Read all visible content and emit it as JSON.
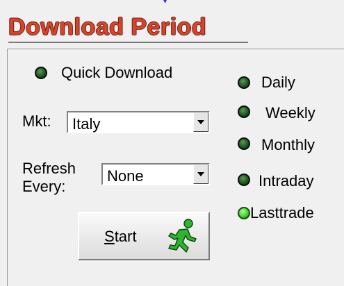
{
  "title": "Download Period",
  "quick_download": {
    "label": "Quick Download"
  },
  "market": {
    "label": "Mkt:",
    "value": "Italy"
  },
  "refresh": {
    "label_line1": "Refresh",
    "label_line2": "Every:",
    "value": "None"
  },
  "start_button": {
    "mnemonic": "S",
    "rest": "tart"
  },
  "periods": [
    {
      "label": "Daily",
      "active": false
    },
    {
      "label": "Weekly",
      "active": false
    },
    {
      "label": "Monthly",
      "active": false
    },
    {
      "label": "Intraday",
      "active": false
    },
    {
      "label": "Lasttrade",
      "active": true
    }
  ],
  "colors": {
    "title": "#d6452b",
    "led_off": "#1e5a1e",
    "led_on": "#45d42e",
    "runner": "#2fb52f"
  },
  "icons": {
    "start_button_icon": "running-man-icon"
  }
}
